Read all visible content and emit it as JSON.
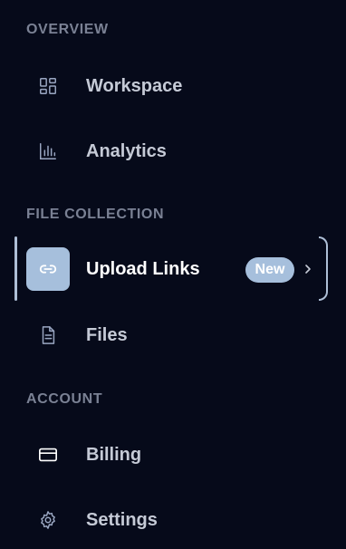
{
  "sections": {
    "overview": "OVERVIEW",
    "file_collection": "FILE COLLECTION",
    "account": "ACCOUNT"
  },
  "items": {
    "workspace": {
      "label": "Workspace",
      "icon": "grid-icon"
    },
    "analytics": {
      "label": "Analytics",
      "icon": "bar-chart-icon"
    },
    "upload_links": {
      "label": "Upload Links",
      "icon": "link-icon",
      "badge": "New",
      "active": true
    },
    "files": {
      "label": "Files",
      "icon": "file-icon"
    },
    "billing": {
      "label": "Billing",
      "icon": "credit-card-icon"
    },
    "settings": {
      "label": "Settings",
      "icon": "gear-icon"
    }
  },
  "colors": {
    "background": "#060a1a",
    "accent": "#a6bfdc",
    "section_label": "#7a8194",
    "item_text": "#c5cad6"
  }
}
